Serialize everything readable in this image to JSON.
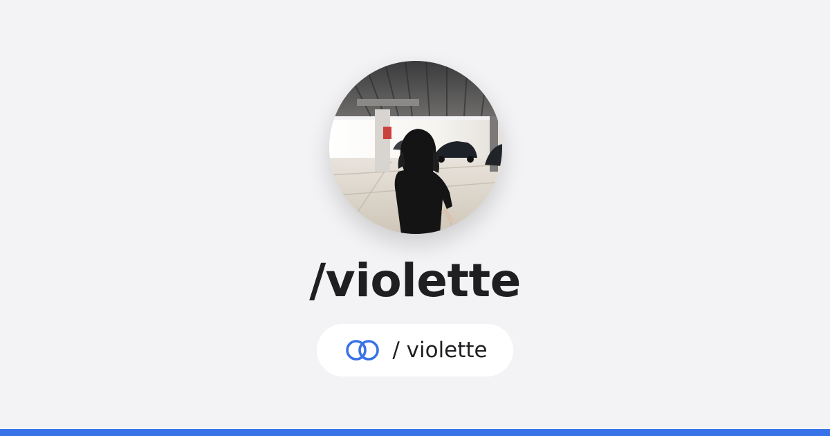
{
  "profile": {
    "title": "/violette",
    "link_text": "/ violette",
    "link_icon": "link-rings-icon",
    "avatar": "profile-photo"
  },
  "colors": {
    "background": "#f3f3f5",
    "accent": "#3872e8",
    "text": "#1f1f22",
    "pill_background": "#ffffff"
  }
}
